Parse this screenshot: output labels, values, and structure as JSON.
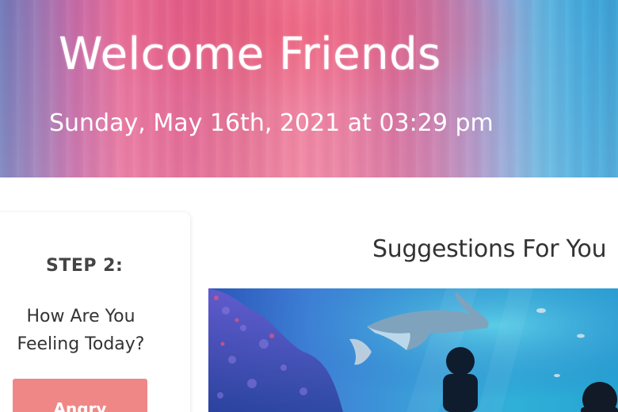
{
  "header": {
    "title": "Welcome Friends",
    "datetime": "Sunday, May 16th, 2021 at 03:29 pm"
  },
  "sidebar": {
    "step": "STEP 2:",
    "question": "How Are You Feeling Today?",
    "mood_button": "Angry",
    "mood_button_color": "#f08787"
  },
  "main": {
    "suggestions_title": "Suggestions For You",
    "image_subject": "aquarium-photo"
  }
}
